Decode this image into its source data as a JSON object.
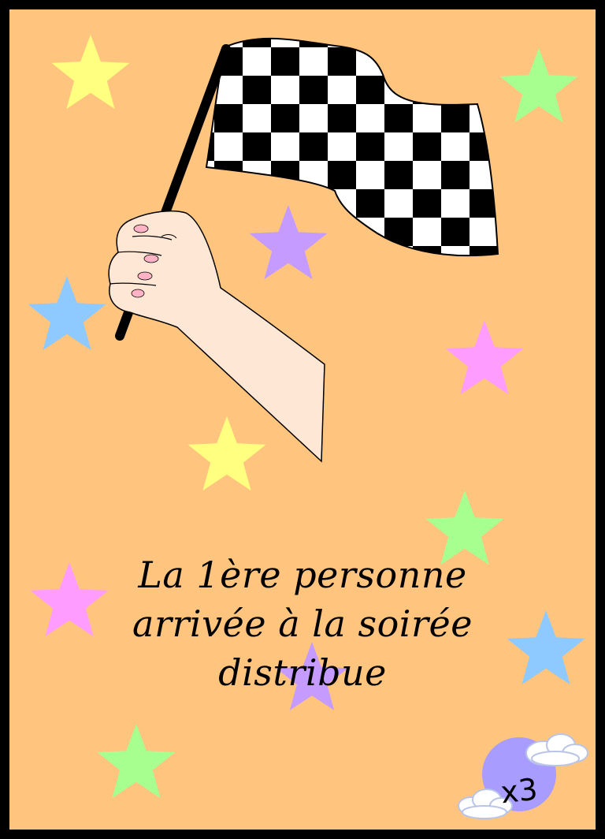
{
  "card": {
    "lines": [
      "La 1ère personne",
      "arrivée à la soirée",
      "distribue"
    ],
    "count_label": "x3"
  },
  "colors": {
    "background": "#ffc57f",
    "border": "#000000",
    "star_yellow": "#ffff80",
    "star_green": "#a6ff8f",
    "star_purple": "#c69bff",
    "star_blue": "#8ec9ff",
    "star_pink": "#ff9cff",
    "badge": "#a89cff"
  },
  "illustration": {
    "icons": [
      "checkered-flag-icon",
      "hand-icon",
      "star-icon",
      "cloud-icon"
    ]
  }
}
